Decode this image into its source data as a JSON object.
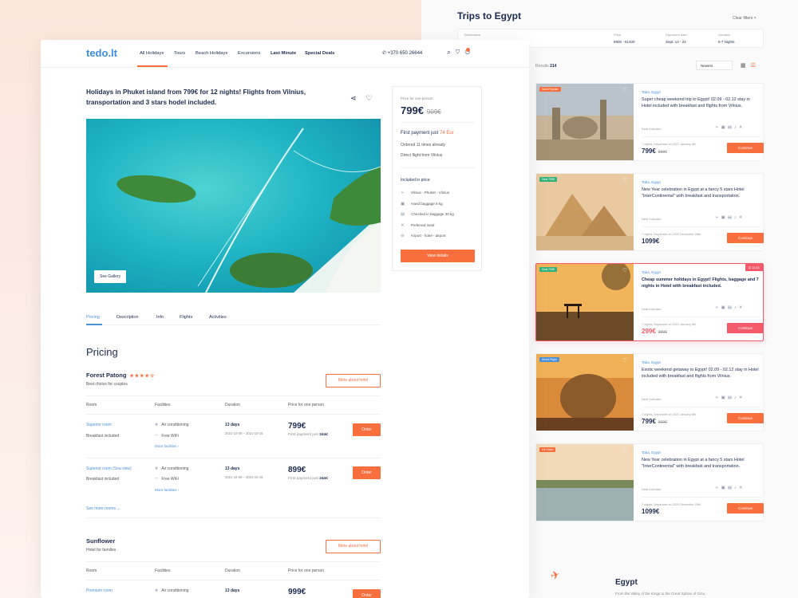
{
  "right_panel": {
    "title": "Trips to Egypt",
    "clear_filters": "Clear filters ×",
    "filters": [
      {
        "label": "Destination",
        "value": "PARIS ×  ROME ×"
      },
      {
        "label": "Price",
        "value": "€900 - €1400"
      },
      {
        "label": "Departure date",
        "value": "Sept. 14 - 22"
      },
      {
        "label": "Duration",
        "value": "6-7 Nights"
      }
    ],
    "results_label": "Results",
    "results_count": "214",
    "sort": "Newest",
    "cards": [
      {
        "badge": "Most Popular",
        "badge_color": "#f96e3d",
        "location": "Taba, Egypt",
        "text": "Super cheap weekend trip to Egypt! 02.09 - 02.12 stay in Hotel included with breakfast and flights from Vilnius.",
        "deal": "Deal includes:",
        "nights": "7 nights, Departure on 2021 January 8th",
        "price": "799€",
        "old": "909€",
        "button": "Continue"
      },
      {
        "badge": "Deal 799€",
        "badge_color": "#35b07a",
        "location": "Taba, Egypt",
        "text": "New Year celebration in Egypt at a fancy 5 stars Hotel \"InterContinental\" with breakfast and transportation.",
        "deal": "Deal includes:",
        "nights": "7 nights, Departure on 2020 December 28th",
        "price": "1099€",
        "old": "",
        "button": "Continue"
      },
      {
        "badge": "Deal 799€",
        "badge_color": "#35b07a",
        "location": "Taba, Egypt",
        "text": "Cheap summer holidays in Egypt! Flights, baggage and 7 nights in Hotel with breakfast included.",
        "deal": "Deal includes:",
        "nights": "7 nights, Departure on 2021 January 8th",
        "price": "299€",
        "old": "399€",
        "button": "Continue",
        "timer": "14:51"
      },
      {
        "badge": "Direct Flight",
        "badge_color": "#4a90d9",
        "location": "Taba, Egypt",
        "text": "Exotic weekend getaway to Egypt! 02.09 - 02.12 stay in Hotel included with breakfast and flights from Vilnius.",
        "deal": "Deal includes:",
        "nights": "7 nights, Departure on 2021 January 8th",
        "price": "799€",
        "old": "909€",
        "button": "Continue"
      },
      {
        "badge": "5★ Hotel",
        "badge_color": "#f96e3d",
        "location": "Taba, Egypt",
        "text": "New Year celebration in Egypt at a fancy 5 stars Hotel \"InterContinental\" with breakfast and transportation.",
        "deal": "Deal includes:",
        "nights": "7 nights, Departure on 2020 December 28th",
        "price": "1099€",
        "old": "",
        "button": "Continue"
      }
    ],
    "egypt_title": "Egypt",
    "egypt_sub": "From the Valley of the Kings to the Great Sphinx of Giza,"
  },
  "header": {
    "logo": "tedo.lt",
    "nav": [
      "All Holidays",
      "Tours",
      "Beach Holidays",
      "Excursions",
      "Last Minute",
      "Special Deals"
    ],
    "phone": "+370 650 26644"
  },
  "listing": {
    "title": "Holidays in Phuket island from 799€ for 12 nights! Flights from Vilnius, transportation and 3 stars hodel included.",
    "gallery": "See Gallery"
  },
  "price_box": {
    "label": "Price for one person:",
    "price": "799€",
    "old": "909€",
    "first_payment": "First payment just",
    "first_amount": "74 Eur",
    "ordered": "Ordered 11 times already",
    "direct": "Direct flight from Vilnius",
    "included_title": "Included in price:",
    "included": [
      "Vilnius - Phuket - Vilnius",
      "Hand baggage 8 kg",
      "Checked in baggage 30 kg",
      "Preferred meal",
      "Airport - hotel - airport"
    ],
    "button": "View details"
  },
  "tabs": [
    "Pricing",
    "Description",
    "Info",
    "Flights",
    "Activities"
  ],
  "pricing": {
    "heading": "Pricing",
    "hotels": [
      {
        "name": "Forest Patong",
        "stars": "★★★★☆",
        "sub": "Best choice for couples",
        "more": "More about hotel"
      },
      {
        "name": "Sunflower",
        "stars": "",
        "sub": "Hotel for families",
        "more": "More about hotel"
      }
    ],
    "headers": [
      "Room",
      "Facilities",
      "Duration",
      "Price for one person"
    ],
    "rooms": [
      {
        "name": "Superior room",
        "sub": "Breakfast included",
        "f1": "Air conditioning",
        "f2": "Free WiFi",
        "more": "More facilities ›",
        "dur": "13 days",
        "dates": "2021-10-09 – 2021-10-16",
        "price": "799€",
        "first": "First payment just",
        "first_amt": "244€",
        "order": "Order"
      },
      {
        "name": "Superior room (Sea view)",
        "sub": "Breakfast included",
        "f1": "Air conditioning",
        "f2": "Free WiFi",
        "more": "More facilities ›",
        "dur": "13 days",
        "dates": "2021-10-09 – 2021-10-16",
        "price": "899€",
        "first": "First payment just",
        "first_amt": "244€",
        "order": "Order"
      },
      {
        "name": "Premium room",
        "sub": "",
        "f1": "Air conditioning",
        "f2": "",
        "more": "",
        "dur": "13 days",
        "dates": "",
        "price": "999€",
        "first": "",
        "first_amt": "",
        "order": "Order"
      }
    ],
    "see_more": "See more rooms ⌄"
  }
}
